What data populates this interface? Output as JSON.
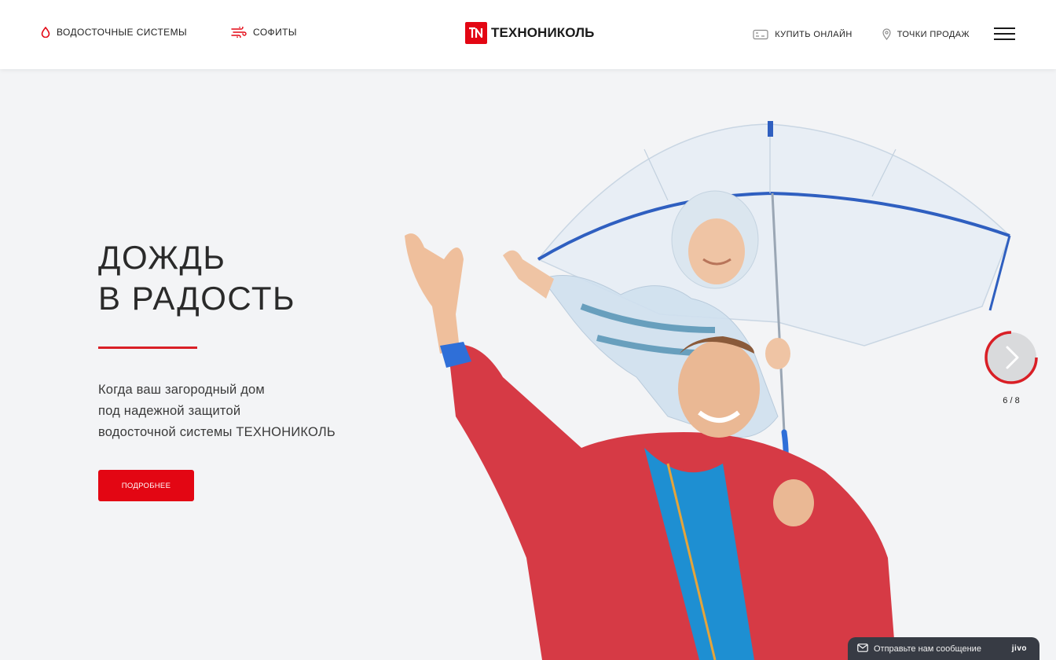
{
  "header": {
    "nav_left": [
      {
        "label": "ВОДОСТОЧНЫЕ СИСТЕМЫ",
        "icon": "drop-icon"
      },
      {
        "label": "СОФИТЫ",
        "icon": "wind-icon"
      }
    ],
    "logo_text": "ТЕХНОНИКОЛЬ",
    "nav_right": [
      {
        "label": "КУПИТЬ ОНЛАЙН",
        "icon": "cart-icon"
      },
      {
        "label": "ТОЧКИ ПРОДАЖ",
        "icon": "location-pin-icon"
      }
    ],
    "menu_icon": "hamburger-icon"
  },
  "hero": {
    "title_line1": "ДОЖДЬ",
    "title_line2": "В РАДОСТЬ",
    "subtitle_line1": "Когда ваш загородный дом",
    "subtitle_line2": "под надежной защитой",
    "subtitle_line3": "водосточной системы ТЕХНОНИКОЛЬ",
    "cta_label": "ПОДРОБНЕЕ"
  },
  "slider": {
    "counter": "6 / 8",
    "current": 6,
    "total": 8
  },
  "chat": {
    "label": "Отправьте нам сообщение",
    "brand": "jivo"
  },
  "colors": {
    "accent": "#e30613",
    "background": "#f3f4f6",
    "chat_bg": "#373b44"
  }
}
